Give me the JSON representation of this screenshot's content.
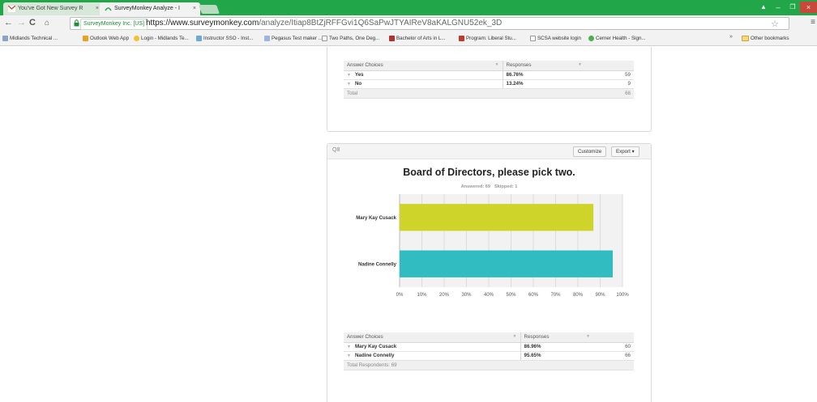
{
  "browser": {
    "tabs": [
      {
        "label": "You've Got New Survey R",
        "active": false
      },
      {
        "label": "SurveyMonkey Analyze - I",
        "active": true
      }
    ],
    "site_badge": "SurveyMonkey Inc. [US]",
    "url_scheme_host": "https://www.surveymonkey.com",
    "url_path": "/analyze/Itiap8BtZjRFFGvi1Q6SaPwJTYAIReV8aKALGNU52ek_3D",
    "bookmarks": [
      "Midlands Technical ...",
      "Outlook Web App",
      "Login - Midlands Te...",
      "Instructor SSO - Inst...",
      "Pegasus Test maker ...",
      "Two Paths, One Deg...",
      "Bachelor of Arts in L...",
      "Program: Liberal Stu...",
      "SCSA website login",
      "Cerner Health - Sign..."
    ],
    "bookmarks_overflow": "»",
    "other_bookmarks": "Other bookmarks"
  },
  "prev_question": {
    "table": {
      "col_choice": "Answer Choices",
      "col_responses": "Responses",
      "rows": [
        {
          "label": "Yes",
          "percent": "86.76%",
          "count": "59"
        },
        {
          "label": "No",
          "percent": "13.24%",
          "count": "9"
        }
      ],
      "footer_label": "Total",
      "footer_value": "68"
    }
  },
  "question": {
    "number": "Q8",
    "customize_label": "Customize",
    "export_label": "Export ▾",
    "title": "Board of Directors, please pick two.",
    "answered": "Answered: 69",
    "skipped": "Skipped: 1",
    "table": {
      "col_choice": "Answer Choices",
      "col_responses": "Responses",
      "rows": [
        {
          "label": "Mary Kay Cusack",
          "percent": "86.96%",
          "count": "60"
        },
        {
          "label": "Nadine Connelly",
          "percent": "95.65%",
          "count": "66"
        }
      ],
      "footer_label": "Total Respondents: 69"
    }
  },
  "chart_data": {
    "type": "bar",
    "orientation": "horizontal",
    "categories": [
      "Mary Kay Cusack",
      "Nadine Connelly"
    ],
    "values": [
      86.96,
      95.65
    ],
    "colors": [
      "#cfd42b",
      "#30bcc0"
    ],
    "x_ticks": [
      "0%",
      "10%",
      "20%",
      "30%",
      "40%",
      "50%",
      "60%",
      "70%",
      "80%",
      "90%",
      "100%"
    ],
    "xlim": [
      0,
      100
    ],
    "grid": true,
    "title": "Board of Directors, please pick two."
  },
  "colors": {
    "chrome_green": "#21a64a",
    "bar_1": "#cfd42b",
    "bar_2": "#30bcc0"
  }
}
